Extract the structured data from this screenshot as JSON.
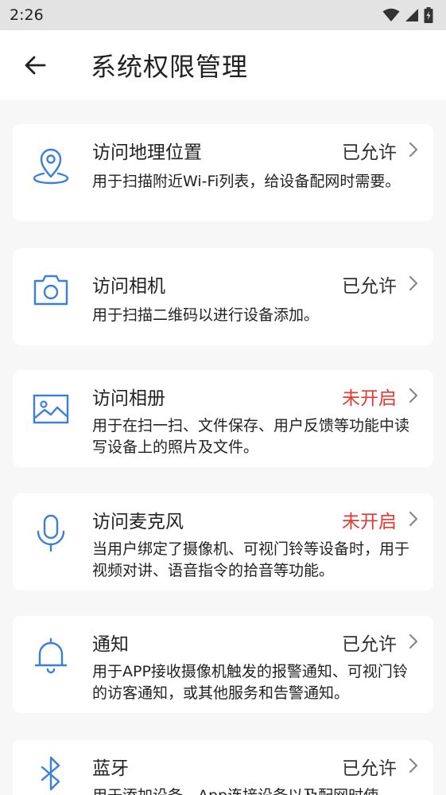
{
  "status_bar": {
    "time": "2:26"
  },
  "header": {
    "title": "系统权限管理"
  },
  "colors": {
    "accent": "#3a7ee0",
    "off": "#e53935"
  },
  "permissions": [
    {
      "icon": "location-pin-icon",
      "title": "访问地理位置",
      "status": "已允许",
      "desc": "用于扫描附近Wi-Fi列表，给设备配网时需要。"
    },
    {
      "icon": "camera-icon",
      "title": "访问相机",
      "status": "已允许",
      "desc": "用于扫描二维码以进行设备添加。"
    },
    {
      "icon": "image-icon",
      "title": "访问相册",
      "status": "未开启",
      "desc": "用于在扫一扫、文件保存、用户反馈等功能中读写设备上的照片及文件。"
    },
    {
      "icon": "microphone-icon",
      "title": "访问麦克风",
      "status": "未开启",
      "desc": "当用户绑定了摄像机、可视门铃等设备时，用于视频对讲、语音指令的拾音等功能。"
    },
    {
      "icon": "bell-icon",
      "title": "通知",
      "status": "已允许",
      "desc": "用于APP接收摄像机触发的报警通知、可视门铃的访客通知，或其他服务和告警通知。"
    },
    {
      "icon": "bluetooth-icon",
      "title": "蓝牙",
      "status": "已允许",
      "desc": "用于添加设备，App连接设备以及配网时使"
    }
  ]
}
